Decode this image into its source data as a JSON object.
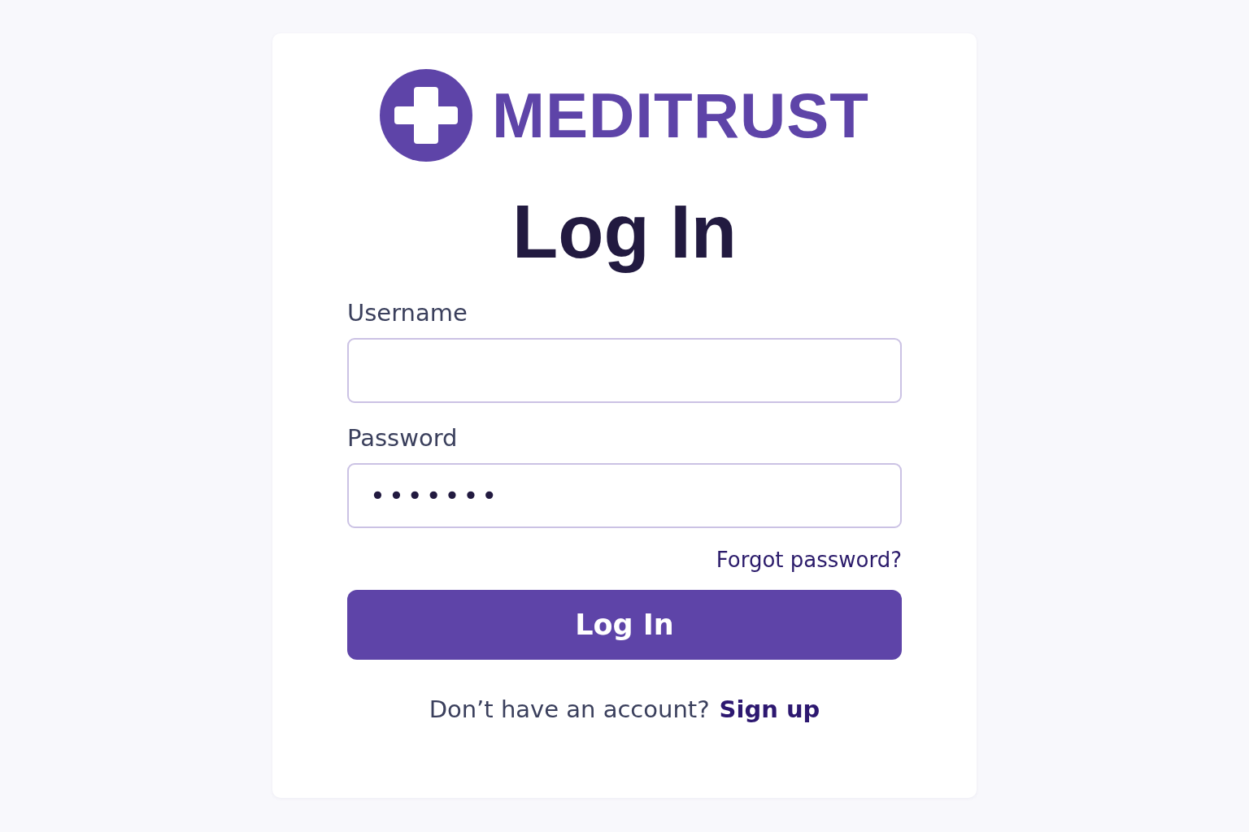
{
  "brand": {
    "name": "MEDITRUST"
  },
  "heading": "Log In",
  "fields": [
    {
      "kind": "text",
      "label": "Username"
    },
    {
      "kind": "password",
      "label": "Password",
      "value": "•••••••"
    }
  ],
  "forgot_link": "Forgot password?",
  "submit_button": "Log In",
  "signup": {
    "prompt": "Don’t have an account?",
    "link": "Sign up"
  }
}
